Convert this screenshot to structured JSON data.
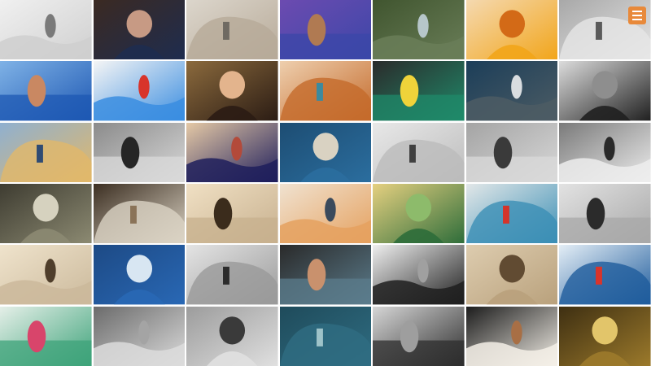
{
  "collage": {
    "columns": 7,
    "rows": 6,
    "tiles": [
      {
        "id": "r1c1",
        "desc": "woman-lying-on-surfboard-bw",
        "palette": [
          "#cfcfcf",
          "#7a7a7a",
          "#f0f0f0"
        ]
      },
      {
        "id": "r1c2",
        "desc": "man-with-sunglasses-gesture",
        "palette": [
          "#1e2c4f",
          "#c79a84",
          "#3b2a22"
        ]
      },
      {
        "id": "r1c3",
        "desc": "feet-on-sand-sepia",
        "palette": [
          "#b7aa98",
          "#6f6a62",
          "#dcd6cc"
        ]
      },
      {
        "id": "r1c4",
        "desc": "woman-with-flower-crown",
        "palette": [
          "#3b47a8",
          "#b07a52",
          "#6c4bb0"
        ]
      },
      {
        "id": "r1c5",
        "desc": "coastline-aerial-view",
        "palette": [
          "#6a7e58",
          "#b6c6c9",
          "#40552f"
        ]
      },
      {
        "id": "r1c6",
        "desc": "blonde-surfer-with-boards",
        "palette": [
          "#f2a51a",
          "#d36a17",
          "#f4d9b0"
        ]
      },
      {
        "id": "r1c7",
        "desc": "woman-hair-flowing-bw",
        "palette": [
          "#e6e6e6",
          "#5b5b5b",
          "#a8a8a8"
        ]
      },
      {
        "id": "r2c1",
        "desc": "surfer-arms-outstretched",
        "palette": [
          "#1e58b3",
          "#c98862",
          "#7fb2e6"
        ]
      },
      {
        "id": "r2c2",
        "desc": "surfer-red-wetsuit-riding",
        "palette": [
          "#3a8de0",
          "#d8342b",
          "#f5f5f5"
        ]
      },
      {
        "id": "r2c3",
        "desc": "woman-holding-trophy",
        "palette": [
          "#2b1c14",
          "#e3b48d",
          "#8b6a3d"
        ]
      },
      {
        "id": "r2c4",
        "desc": "surfer-wipeout-orange-board",
        "palette": [
          "#c46a2b",
          "#3c8a9f",
          "#eecfae"
        ]
      },
      {
        "id": "r2c5",
        "desc": "surfer-yellow-board-green-wave",
        "palette": [
          "#1f8a6a",
          "#efd33a",
          "#2b2b2b"
        ]
      },
      {
        "id": "r2c6",
        "desc": "group-surfing-whitewater",
        "palette": [
          "#4c5c64",
          "#d9dde0",
          "#1c3e59"
        ]
      },
      {
        "id": "r2c7",
        "desc": "barreling-wave-bw",
        "palette": [
          "#202020",
          "#8e8e8e",
          "#dcdcdc"
        ]
      },
      {
        "id": "r3c1",
        "desc": "pier-with-figures-sunset",
        "palette": [
          "#e1b86a",
          "#2f4b73",
          "#8fb0d0"
        ]
      },
      {
        "id": "r3c2",
        "desc": "surfer-silhouette-bw",
        "palette": [
          "#d9d9d9",
          "#262626",
          "#8b8b8b"
        ]
      },
      {
        "id": "r3c3",
        "desc": "surfer-crouching-red-shorts",
        "palette": [
          "#1e1e5c",
          "#b34a3a",
          "#e5c9a6"
        ]
      },
      {
        "id": "r3c4",
        "desc": "surfer-on-board-blue-wave",
        "palette": [
          "#2b6e9f",
          "#d9d2c2",
          "#1d4d73"
        ]
      },
      {
        "id": "r3c5",
        "desc": "surfer-jumping-bw",
        "palette": [
          "#bcbcbc",
          "#404040",
          "#e8e8e8"
        ]
      },
      {
        "id": "r3c6",
        "desc": "lineup-of-people-beach-bw",
        "palette": [
          "#d9d9d9",
          "#3a3a3a",
          "#a4a4a4"
        ]
      },
      {
        "id": "r3c7",
        "desc": "man-portrait-bw",
        "palette": [
          "#ededed",
          "#2a2a2a",
          "#7a7a7a"
        ]
      },
      {
        "id": "r4c1",
        "desc": "surfer-standing-on-wave-sepia",
        "palette": [
          "#8c8a72",
          "#d6d2bf",
          "#3e3c31"
        ]
      },
      {
        "id": "r4c2",
        "desc": "bald-man-pointing-sepia",
        "palette": [
          "#dbd3c4",
          "#8a7358",
          "#3c2f22"
        ]
      },
      {
        "id": "r4c3",
        "desc": "blonde-man-smiling-sepia",
        "palette": [
          "#c7b08e",
          "#3b2c1c",
          "#f0e0c4"
        ]
      },
      {
        "id": "r4c4",
        "desc": "man-in-tshirt-smiling",
        "palette": [
          "#e5a15f",
          "#3a4a5c",
          "#f0e2d0"
        ]
      },
      {
        "id": "r4c5",
        "desc": "surfer-green-wave-tube",
        "palette": [
          "#2e6d3a",
          "#8dbb6b",
          "#e5d080"
        ]
      },
      {
        "id": "r4c6",
        "desc": "surfer-red-shirt-riding",
        "palette": [
          "#3b8fb5",
          "#d4342b",
          "#e2e7e8"
        ]
      },
      {
        "id": "r4c7",
        "desc": "man-closeup-bw",
        "palette": [
          "#a8a8a8",
          "#2b2b2b",
          "#e2e2e2"
        ]
      },
      {
        "id": "r5c1",
        "desc": "two-men-with-trophy-sepia",
        "palette": [
          "#cbb99b",
          "#4f3e2b",
          "#efe3cc"
        ]
      },
      {
        "id": "r5c2",
        "desc": "longboarder-blue-wave",
        "palette": [
          "#2968b5",
          "#d8e6f2",
          "#1d4a85"
        ]
      },
      {
        "id": "r5c3",
        "desc": "surfer-falling-bw",
        "palette": [
          "#9a9a9a",
          "#2c2c2c",
          "#e4e4e4"
        ]
      },
      {
        "id": "r5c4",
        "desc": "man-face-closeup-color",
        "palette": [
          "#5b7c8c",
          "#c9916d",
          "#2a2a2a"
        ]
      },
      {
        "id": "r5c5",
        "desc": "man-smiling-bw",
        "palette": [
          "#1f1f1f",
          "#a0a0a0",
          "#efefef"
        ]
      },
      {
        "id": "r5c6",
        "desc": "surfer-carving-sepia",
        "palette": [
          "#b9a17c",
          "#614b32",
          "#ddccaf"
        ]
      },
      {
        "id": "r5c7",
        "desc": "surfer-red-wetsuit-blue-wave",
        "palette": [
          "#1f5c9c",
          "#d9342b",
          "#e4eef6"
        ]
      },
      {
        "id": "r6c1",
        "desc": "surfer-pink-shirt-wave",
        "palette": [
          "#3da37a",
          "#d8456b",
          "#e5efe8"
        ]
      },
      {
        "id": "r6c2",
        "desc": "beach-landscape-misty",
        "palette": [
          "#dcdcdc",
          "#a4a4a4",
          "#6b6b6b"
        ]
      },
      {
        "id": "r6c3",
        "desc": "man-standing-beach-bw",
        "palette": [
          "#e0e0e0",
          "#3a3a3a",
          "#9c9c9c"
        ]
      },
      {
        "id": "r6c4",
        "desc": "ocean-waves-teal",
        "palette": [
          "#2f6d82",
          "#9ec3c9",
          "#1f4b5b"
        ]
      },
      {
        "id": "r6c5",
        "desc": "two-men-in-suits-bw",
        "palette": [
          "#2d2d2d",
          "#9e9e9e",
          "#d6d6d6"
        ]
      },
      {
        "id": "r6c6",
        "desc": "man-hat-lei-laughing",
        "palette": [
          "#f4f0e8",
          "#a86f45",
          "#1c1c1c"
        ]
      },
      {
        "id": "r6c7",
        "desc": "surfer-inside-barrel-gold",
        "palette": [
          "#9c7a2b",
          "#e2c56a",
          "#3e2f12"
        ]
      }
    ]
  },
  "overlay": {
    "menu_icon": "menu-icon",
    "menu_color": "#e8893a"
  }
}
